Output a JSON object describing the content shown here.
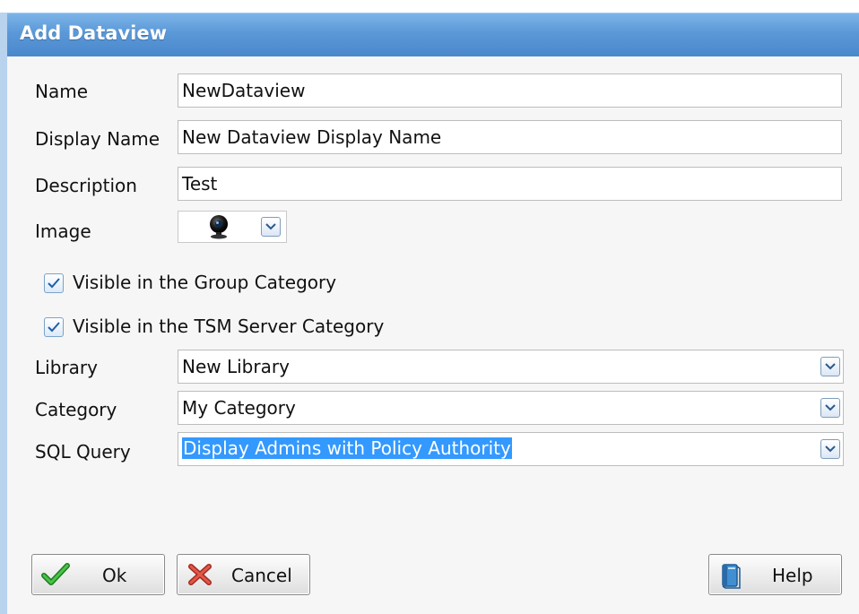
{
  "window": {
    "title": "Add Dataview"
  },
  "form": {
    "name": {
      "label": "Name",
      "value": "NewDataview"
    },
    "display_name": {
      "label": "Display Name",
      "value": "New Dataview Display Name"
    },
    "description": {
      "label": "Description",
      "value": "Test"
    },
    "image": {
      "label": "Image",
      "selected_icon": "webcam-icon"
    },
    "visible_group": {
      "label": "Visible in the Group Category",
      "checked": true
    },
    "visible_tsm": {
      "label": "Visible in the TSM Server Category",
      "checked": true
    },
    "library": {
      "label": "Library",
      "value": "New Library"
    },
    "category": {
      "label": "Category",
      "value": "My Category"
    },
    "sql_query": {
      "label": "SQL Query",
      "value": "Display Admins with Policy Authority",
      "selected": true
    }
  },
  "buttons": {
    "ok": {
      "label": "Ok",
      "icon": "checkmark-icon"
    },
    "cancel": {
      "label": "Cancel",
      "icon": "x-icon"
    },
    "help": {
      "label": "Help",
      "icon": "book-icon"
    }
  },
  "colors": {
    "titlebar": "#5a98d8",
    "selection": "#3399ff",
    "ok_green": "#2e9a2e",
    "cancel_red": "#c0392b"
  }
}
